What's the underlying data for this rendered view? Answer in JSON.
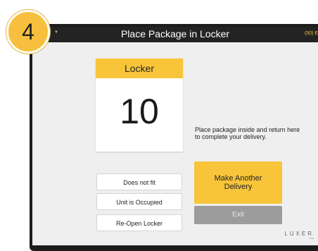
{
  "step": {
    "number": "4"
  },
  "header": {
    "title": "Place Package in Locker",
    "status": "(50) E",
    "menu_glyph": "▼"
  },
  "locker": {
    "label": "Locker",
    "number": "10"
  },
  "instructions": "Place package inside and return here to complete your delivery.",
  "options": [
    {
      "label": "Does not fit"
    },
    {
      "label": "Unit is Occupied"
    },
    {
      "label": "Re-Open Locker"
    }
  ],
  "actions": {
    "another_delivery": "Make Another Delivery",
    "exit": "Exit"
  },
  "brand": {
    "name": "LUXER",
    "tagline": "ONE"
  },
  "colors": {
    "accent": "#f8c53a",
    "topbar": "#232323",
    "exit_button": "#9c9c9c",
    "background": "#efefef"
  }
}
